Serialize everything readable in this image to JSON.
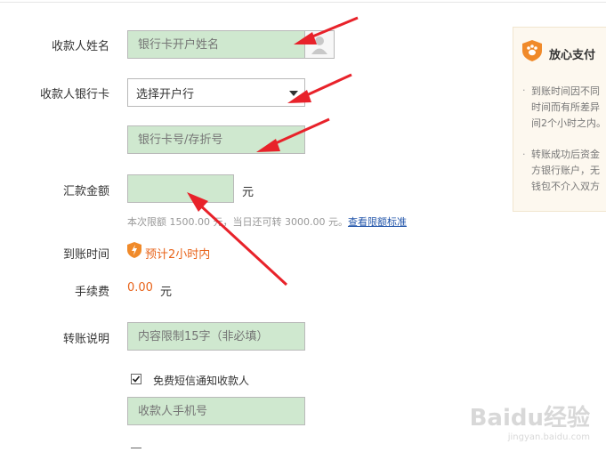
{
  "form": {
    "payee_name_label": "收款人姓名",
    "payee_name_placeholder": "银行卡开户姓名",
    "payee_bank_label": "收款人银行卡",
    "bank_select_value": "选择开户行",
    "card_number_placeholder": "银行卡号/存折号",
    "amount_label": "汇款金额",
    "amount_unit": "元",
    "limit_hint": "本次限额 1500.00 元，当日还可转 3000.00 元。",
    "limit_link": "查看限额标准",
    "arrival_label": "到账时间",
    "arrival_value": "预计2小时内",
    "fee_label": "手续费",
    "fee_value": "0.00",
    "fee_unit": "元",
    "note_label": "转账说明",
    "note_placeholder": "内容限制15字（非必填）",
    "sms_checkbox_label": "免费短信通知收款人",
    "sms_checked": true,
    "phone_placeholder": "收款人手机号"
  },
  "side_panel": {
    "title": "放心支付",
    "bullet1_lines": [
      "到账时间因不同",
      "时间而有所差异",
      "间2个小时之内。"
    ],
    "bullet2_lines": [
      "转账成功后资金",
      "方银行账户，无",
      "钱包不介入双方"
    ]
  },
  "watermark": {
    "brand": "Baidu经验",
    "url": "jingyan.baidu.com"
  },
  "colors": {
    "field_bg": "#cfe8cf",
    "accent": "#e8641b",
    "arrow": "#e8222a"
  }
}
